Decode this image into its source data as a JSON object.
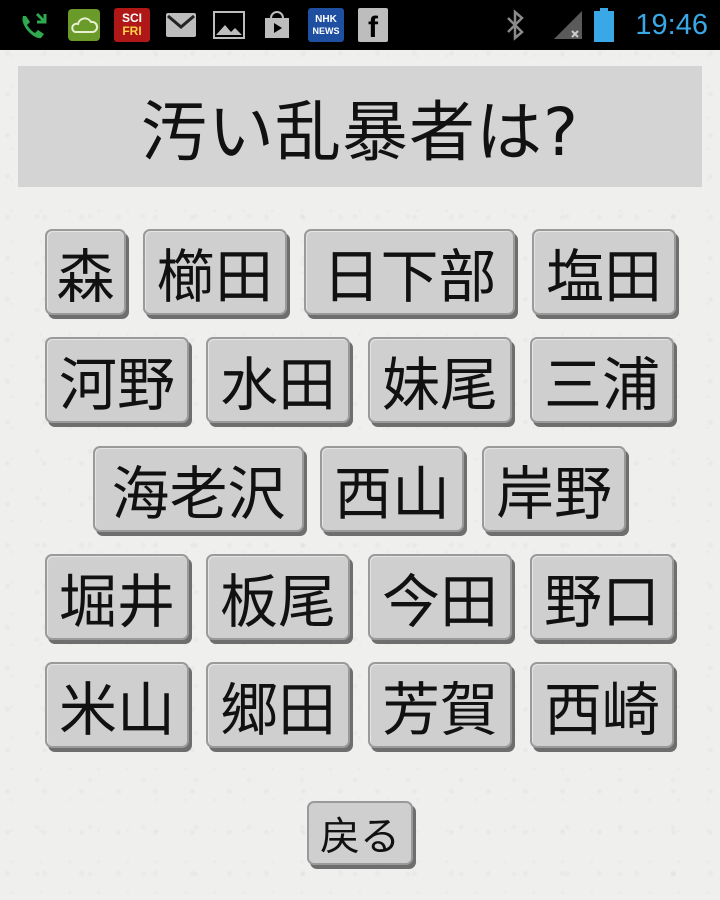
{
  "status_bar": {
    "time": "19:46",
    "icons": [
      "missed-call-icon",
      "weather-cloud-icon",
      "sci-fri-app-icon",
      "gmail-icon",
      "gallery-icon",
      "play-store-icon",
      "nhk-news-icon",
      "facebook-icon",
      "bluetooth-icon",
      "signal-icon",
      "battery-icon"
    ],
    "scifri_label_top": "SCI",
    "scifri_label_bottom": "FRI",
    "nhk_label_top": "NHK",
    "nhk_label_bottom": "NEWS",
    "facebook_label": "f",
    "gmail_label": "M",
    "accent_color": "#3aa8e6"
  },
  "question": "汚い乱暴者は?",
  "answers": [
    "森",
    "櫛田",
    "日下部",
    "塩田",
    "河野",
    "水田",
    "妹尾",
    "三浦",
    "海老沢",
    "西山",
    "岸野",
    "堀井",
    "板尾",
    "今田",
    "野口",
    "米山",
    "郷田",
    "芳賀",
    "西崎"
  ],
  "back_label": "戻る"
}
